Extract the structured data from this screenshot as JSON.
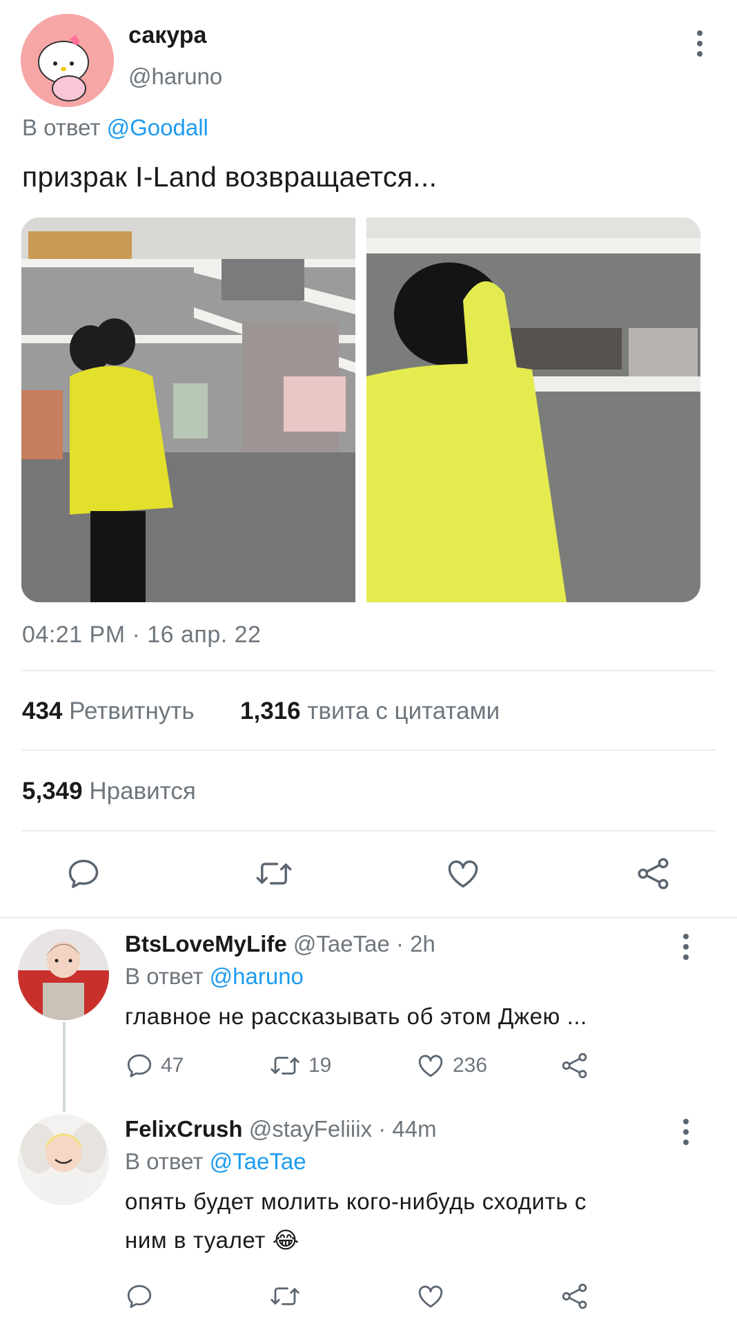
{
  "tweet": {
    "display_name": "сакура",
    "handle": "@haruno",
    "reply_prefix": "В ответ",
    "reply_to": "@Goodall",
    "text": "призрак I-Land возвращается...",
    "timestamp": "04:21 PM · 16 апр. 22",
    "stats": {
      "retweets_count": "434",
      "retweets_label": "Ретвитнуть",
      "quotes_count": "1,316",
      "quotes_label": "твита с цитатами",
      "likes_count": "5,349",
      "likes_label": "Нравится"
    },
    "actions": [
      "reply-icon",
      "retweet-icon",
      "like-icon",
      "share-icon"
    ]
  },
  "replies": [
    {
      "display_name": "BtsLoveMyLife",
      "handle": "@TaeTae",
      "time": "· 2h",
      "reply_prefix": "В ответ",
      "reply_to": "@haruno",
      "text": "главное не рассказывать об этом Джею ...",
      "reply_count": "47",
      "retweet_count": "19",
      "like_count": "236"
    },
    {
      "display_name": "FelixCrush",
      "handle": "@stayFeliiix",
      "time": "· 44m",
      "reply_prefix": "В ответ",
      "reply_to": "@TaeTae",
      "text_line1": "опять будет молить кого-нибудь сходить с",
      "text_line2": "ним в туалет",
      "emoji": "😂"
    }
  ],
  "colors": {
    "accent": "#1d9bf0",
    "muted": "#6e767d",
    "avatar_bg": "#f7a6a6"
  }
}
